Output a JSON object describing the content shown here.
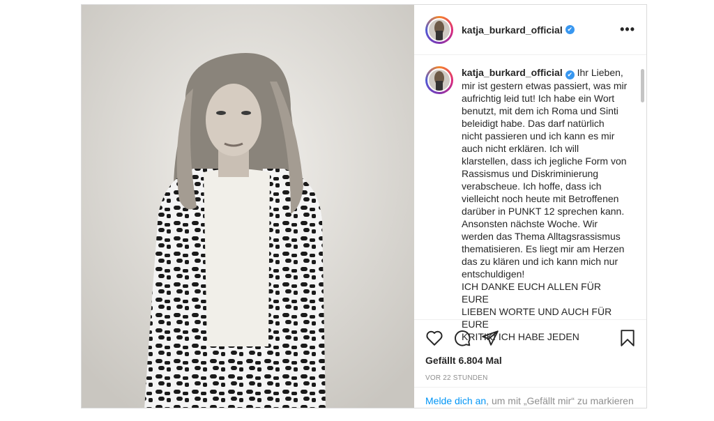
{
  "post": {
    "username": "katja_burkard_official",
    "verified": true,
    "more_icon": "•••",
    "caption_lines": [
      "Ihr Lieben,",
      "mir ist gestern etwas passiert, was mir",
      "aufrichtig leid tut! Ich habe ein Wort",
      "benutzt, mit dem ich Roma und Sinti",
      "beleidigt habe. Das darf natürlich",
      "nicht passieren und ich kann es mir",
      "auch nicht erklären. Ich will",
      "klarstellen, dass ich jegliche Form von",
      "Rassismus und Diskriminierung",
      "verabscheue. Ich hoffe, dass ich",
      "vielleicht noch heute mit Betroffenen",
      "darüber in PUNKT 12 sprechen kann.",
      "Ansonsten nächste Woche. Wir",
      "werden das Thema Alltagsrassismus",
      "thematisieren. Es liegt mir am Herzen",
      "das zu klären und ich kann mich nur",
      "entschuldigen!",
      "ICH DANKE EUCH ALLEN FÜR EURE",
      "LIEBEN WORTE UND AUCH FÜR EURE",
      "KRITIK! ICH HABE JEDEN"
    ],
    "likes": "Gefällt 6.804 Mal",
    "time": "VOR 22 STUNDEN",
    "login_link": "Melde dich an",
    "login_rest": ", um mit „Gefällt mir“ zu markieren"
  },
  "icons": {
    "like": "heart-icon",
    "comment": "comment-icon",
    "share": "send-icon",
    "save": "bookmark-icon"
  },
  "colors": {
    "link": "#0095f6",
    "verified": "#3897f0"
  }
}
